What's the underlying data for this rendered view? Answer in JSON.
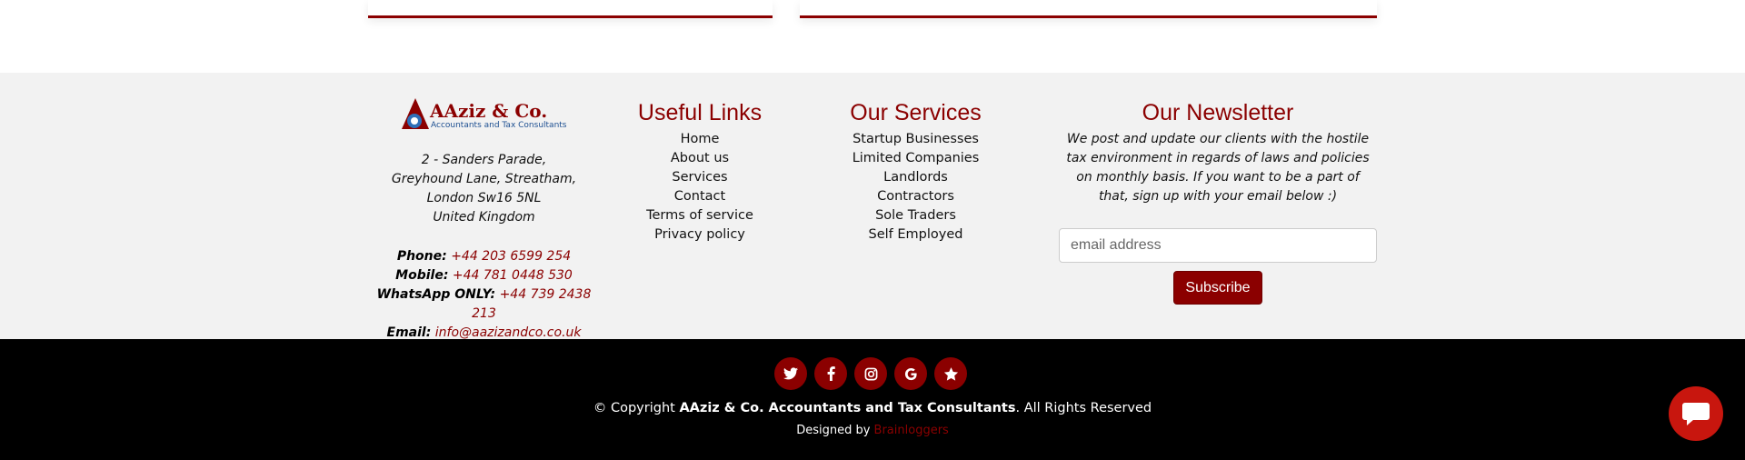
{
  "brand": {
    "name": "AAziz & Co.",
    "tagline": "Accountants and Tax Consultants"
  },
  "address": [
    "2 - Sanders Parade,",
    "Greyhound Lane, Streatham,",
    "London Sw16 5NL",
    "United Kingdom"
  ],
  "contact": {
    "phone_label": "Phone:",
    "phone": "+44 203 6599 254",
    "mobile_label": "Mobile:",
    "mobile": "+44 781 0448 530",
    "whatsapp_label": "WhatsApp ONLY:",
    "whatsapp": "+44 739 2438 213",
    "email_label": "Email:",
    "email": "info@aazizandco.co.uk"
  },
  "useful_links": {
    "title": "Useful Links",
    "items": [
      "Home",
      "About us",
      "Services",
      "Contact",
      "Terms of service",
      "Privacy policy"
    ]
  },
  "services": {
    "title": "Our Services",
    "items": [
      "Startup Businesses",
      "Limited Companies",
      "Landlords",
      "Contractors",
      "Sole Traders",
      "Self Employed"
    ]
  },
  "newsletter": {
    "title": "Our Newsletter",
    "text": "We post and update our clients with the hostile tax environment in regards of laws and policies on monthly basis. If you want to be a part of that, sign up with your email below :)",
    "placeholder": "email address",
    "button": "Subscribe"
  },
  "social_icons": [
    "twitter-icon",
    "facebook-icon",
    "instagram-icon",
    "google-icon",
    "star-icon"
  ],
  "copyright": {
    "prefix": "© Copyright ",
    "company": "AAziz & Co. Accountants and Tax Consultants",
    "suffix": ". All Rights Reserved"
  },
  "designed": {
    "prefix": "Designed by ",
    "developer": "Brainloggers"
  },
  "colors": {
    "accent": "#8b0000",
    "footer_bg": "#f2f2f2",
    "bottom_bg": "#000000",
    "chat": "#c8160e"
  }
}
